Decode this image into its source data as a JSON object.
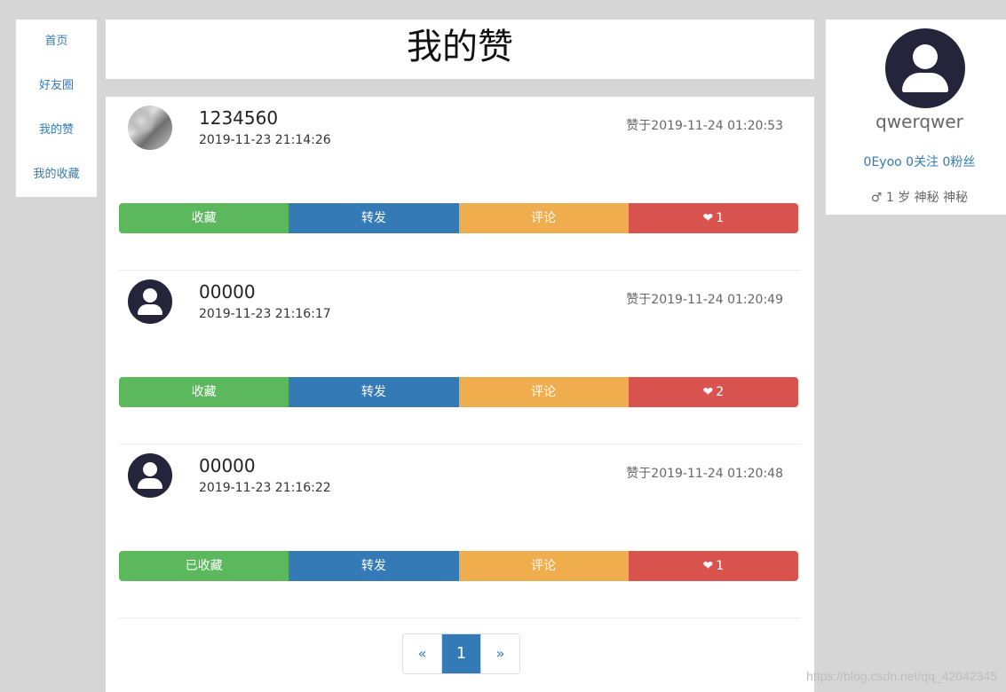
{
  "nav": {
    "items": [
      "首页",
      "好友圈",
      "我的赞",
      "我的收藏"
    ]
  },
  "header": {
    "title": "我的赞"
  },
  "posts": [
    {
      "name": "1234560",
      "date": "2019-11-23 21:14:26",
      "liked_at": "赞于2019-11-24 01:20:53",
      "avatar": "photo-avatar",
      "buttons": {
        "favorite": "收藏",
        "forward": "转发",
        "comment": "评论",
        "like_count": "1"
      }
    },
    {
      "name": "00000",
      "date": "2019-11-23 21:16:17",
      "liked_at": "赞于2019-11-24 01:20:49",
      "avatar": "default-user-avatar",
      "buttons": {
        "favorite": "收藏",
        "forward": "转发",
        "comment": "评论",
        "like_count": "2"
      }
    },
    {
      "name": "00000",
      "date": "2019-11-23 21:16:22",
      "liked_at": "赞于2019-11-24 01:20:48",
      "avatar": "default-user-avatar",
      "buttons": {
        "favorite": "已收藏",
        "forward": "转发",
        "comment": "评论",
        "like_count": "1"
      }
    }
  ],
  "pagination": {
    "prev": "«",
    "current": "1",
    "next": "»"
  },
  "profile": {
    "username": "qwerqwer",
    "stats": "0Eyoo 0关注 0粉丝",
    "info": "♂ 1 岁 神秘 神秘"
  },
  "watermark": "https://blog.csdn.net/qq_42042345",
  "colors": {
    "favorite": "#5cb85c",
    "forward": "#337ab7",
    "comment": "#f0ad4e",
    "like": "#d9534f"
  }
}
